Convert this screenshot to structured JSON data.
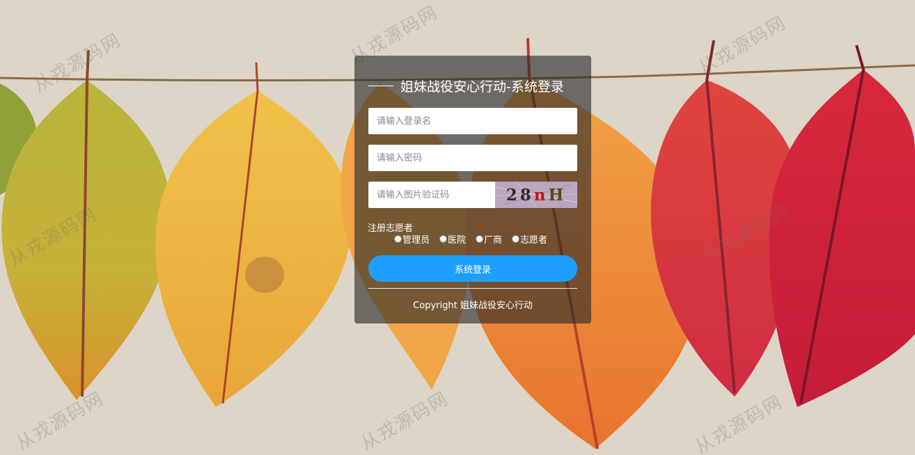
{
  "login": {
    "title": "姐妹战役安心行动-系统登录",
    "username_placeholder": "请输入登录名",
    "password_placeholder": "请输入密码",
    "captcha_placeholder": "请输入图片验证码",
    "captcha_chars": [
      "2",
      "8",
      "n",
      "H"
    ],
    "captcha_colors": [
      "#3a2a1a",
      "#3a2a1a",
      "#d01010",
      "#5a4a10"
    ],
    "register_label": "注册志愿者",
    "roles": [
      "管理员",
      "医院",
      "厂商",
      "志愿者"
    ],
    "submit_label": "系统登录",
    "copyright": "Copyright 姐妹战役安心行动"
  },
  "background": {
    "watermark_text": "从戎源码网"
  },
  "colors": {
    "accent": "#1e9fff",
    "panel": "rgba(40,40,40,0.62)"
  }
}
